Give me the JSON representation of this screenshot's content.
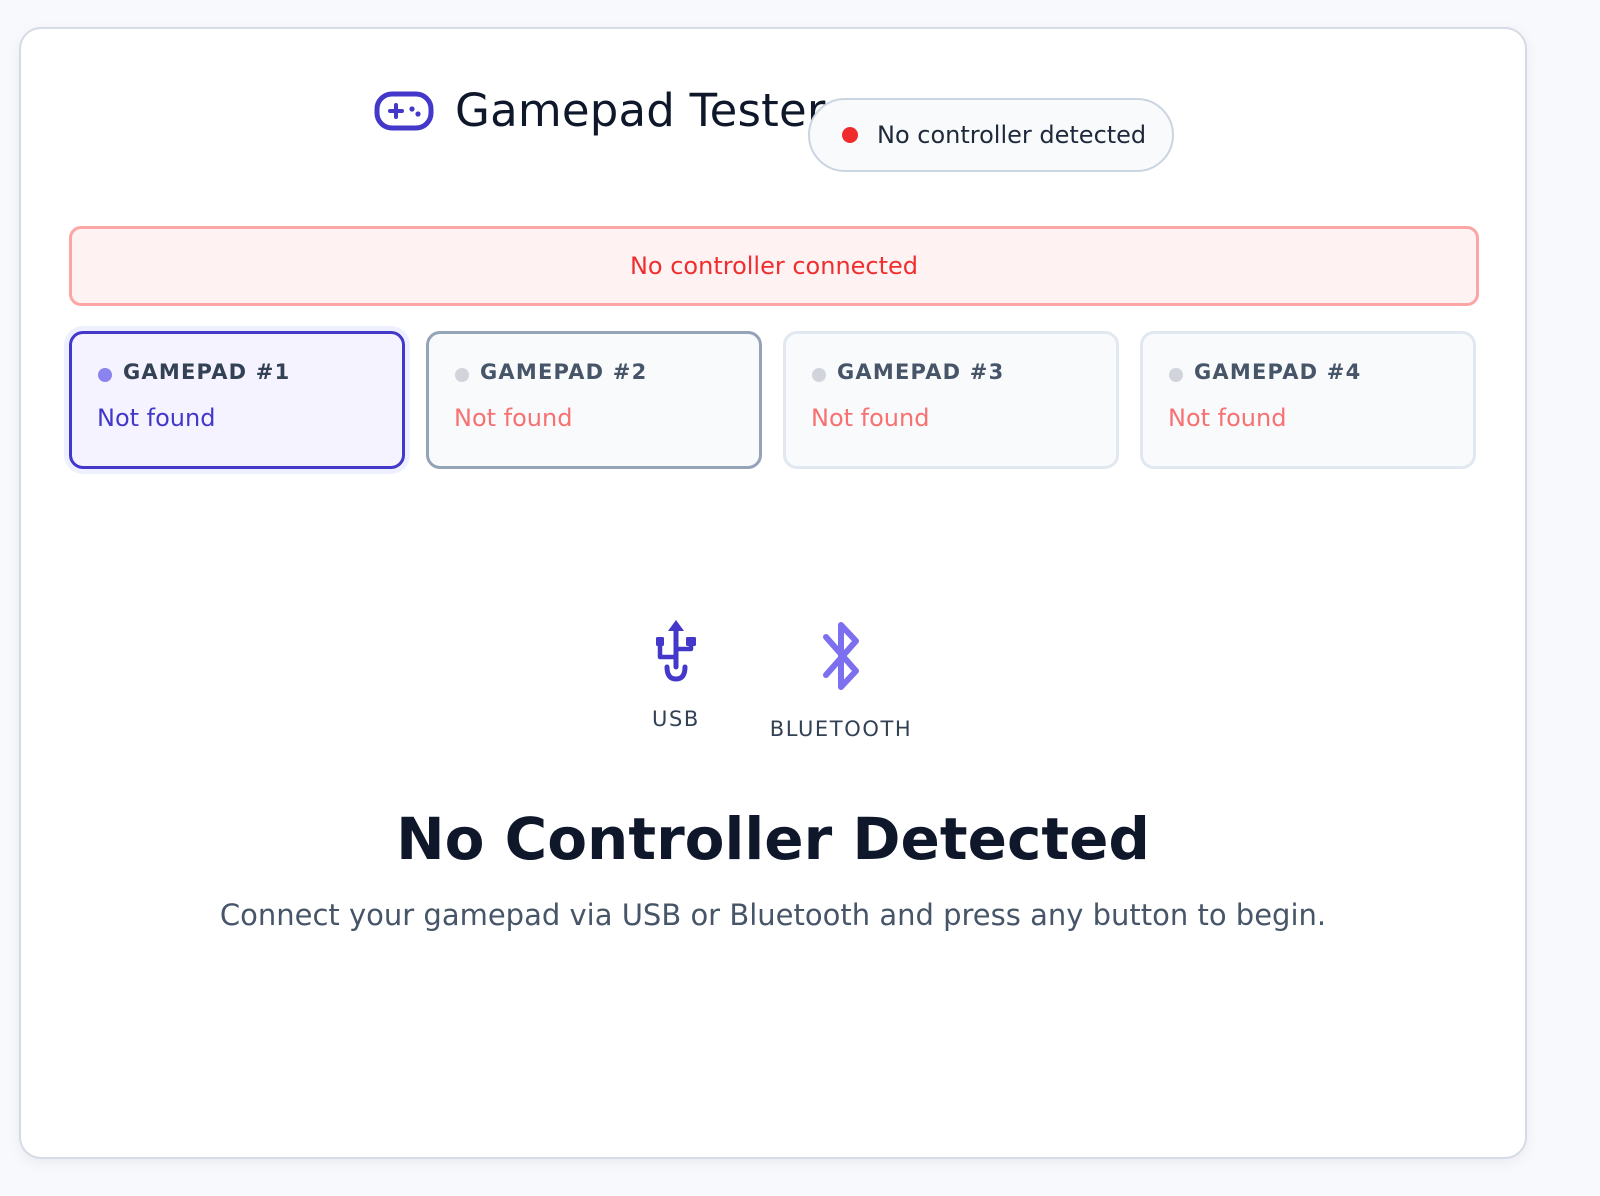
{
  "header": {
    "title": "Gamepad Tester",
    "logo_icon": "gamepad-icon",
    "status": {
      "text": "No controller detected",
      "dot_color": "#ef2b2b"
    }
  },
  "alert": {
    "text": "No controller connected"
  },
  "slots": [
    {
      "name": "GAMEPAD #1",
      "status": "Not found",
      "selected": true
    },
    {
      "name": "GAMEPAD #2",
      "status": "Not found",
      "selected": false
    },
    {
      "name": "GAMEPAD #3",
      "status": "Not found",
      "selected": false
    },
    {
      "name": "GAMEPAD #4",
      "status": "Not found",
      "selected": false
    }
  ],
  "connections": [
    {
      "label": "USB",
      "icon": "usb-icon"
    },
    {
      "label": "BLUETOOTH",
      "icon": "bluetooth-icon"
    }
  ],
  "empty_state": {
    "title": "No Controller Detected",
    "subtitle": "Connect your gamepad via USB or Bluetooth and press any button to begin."
  },
  "colors": {
    "accent": "#4338ca",
    "icon_accent": "#6c5ce7",
    "alert_text": "#ef2f2f",
    "alert_border": "#fca5a5",
    "not_found": "#f87171"
  }
}
